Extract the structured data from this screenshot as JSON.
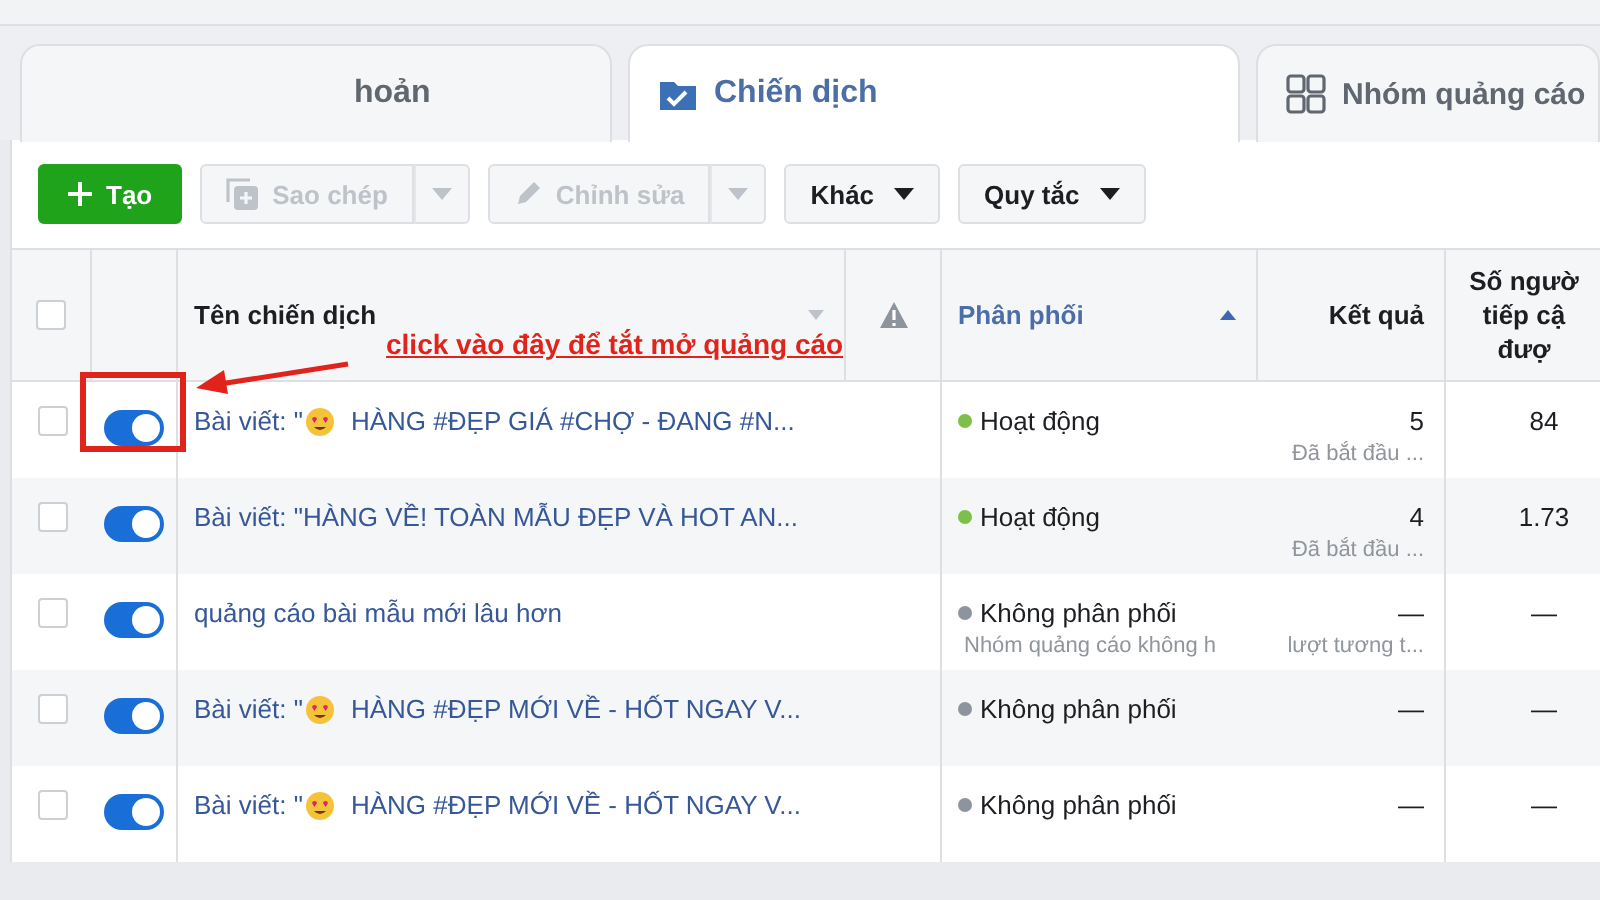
{
  "tabs": [
    {
      "label": "hoản",
      "selected": false
    },
    {
      "label": "Chiến dịch",
      "selected": true
    },
    {
      "label": "Nhóm quảng cáo",
      "selected": false
    }
  ],
  "toolbar": [
    {
      "label": "Tạo",
      "kind": "create",
      "disabled": false
    },
    {
      "label": "Sao chép",
      "kind": "copy",
      "disabled": true
    },
    {
      "label": "Chỉnh sửa",
      "kind": "edit",
      "disabled": true
    },
    {
      "label": "Khác",
      "kind": "menu",
      "disabled": false
    },
    {
      "label": "Quy tắc",
      "kind": "menu",
      "disabled": false
    }
  ],
  "table": {
    "header_checked": false,
    "columns": [
      {
        "kind": "checkbox"
      },
      {
        "kind": "toggle"
      },
      {
        "kind": "name",
        "label": "Tên chiến dịch",
        "selected": false
      },
      {
        "kind": "warning"
      },
      {
        "kind": "status",
        "label": "Phân phối",
        "selected": true
      },
      {
        "kind": "number",
        "label": "Kết quả",
        "selected": false
      },
      {
        "kind": "number",
        "label": "Số ngườ\ntiếp cậ\nđượ",
        "selected": false
      }
    ],
    "rows": [
      {
        "checked": false,
        "on": true,
        "name_parts": [
          "Bài viết: \"",
          "HÀNG #ĐẸP GIÁ #CHỢ - ĐANG #N..."
        ],
        "emoji": true,
        "status": "Hoạt động",
        "color": "#7cc04b",
        "result": "5",
        "result_note": "Đã bắt đầu ...",
        "reach": "84"
      },
      {
        "checked": false,
        "on": true,
        "name_parts": [
          "Bài viết: \"HÀNG VỀ! TOÀN MẪU ĐẸP VÀ HOT AN..."
        ],
        "emoji": false,
        "status": "Hoạt động",
        "color": "#7cc04b",
        "result": "4",
        "result_note": "Đã bắt đầu ...",
        "reach": "1.73"
      },
      {
        "checked": false,
        "on": true,
        "name_parts": [
          "quảng cáo bài mẫu mới lâu hơn"
        ],
        "emoji": false,
        "status": "Không phân phối",
        "status_note": "Nhóm quảng cáo không h",
        "color": "#8d949e",
        "result": "—",
        "result_note": "lượt tương t...",
        "reach": "—"
      },
      {
        "checked": false,
        "on": true,
        "name_parts": [
          "Bài viết: \"",
          "HÀNG #ĐẸP MỚI VỀ - HỐT NGAY V..."
        ],
        "emoji": true,
        "status": "Không phân phối",
        "color": "#8d949e",
        "result": "—",
        "reach": "—"
      },
      {
        "checked": false,
        "on": true,
        "name_parts": [
          "Bài viết: \"",
          "HÀNG #ĐẸP MỚI VỀ - HỐT NGAY V..."
        ],
        "emoji": true,
        "status": "Không phân phối",
        "color": "#8d949e",
        "result": "—",
        "reach": "—"
      }
    ]
  },
  "annotation": {
    "text": "click vào đây để tắt mở quảng cáo"
  }
}
